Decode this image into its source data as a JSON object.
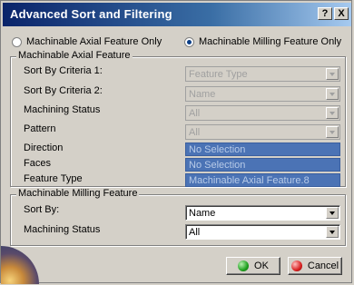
{
  "window": {
    "title": "Advanced Sort and Filtering"
  },
  "titlebar_buttons": {
    "help": "?",
    "close": "X"
  },
  "radios": [
    {
      "label": "Machinable Axial Feature Only",
      "selected": false
    },
    {
      "label": "Machinable Milling Feature Only",
      "selected": true
    }
  ],
  "axial": {
    "title": "Machinable Axial Feature",
    "rows": [
      {
        "label": "Sort By Criteria 1:",
        "value": "Feature Type"
      },
      {
        "label": "Sort By Criteria 2:",
        "value": "Name"
      },
      {
        "label": "Machining Status",
        "value": "All"
      },
      {
        "label": "Pattern",
        "value": "All"
      }
    ],
    "selections": [
      {
        "label": "Direction",
        "value": "No Selection"
      },
      {
        "label": "Faces",
        "value": "No Selection"
      },
      {
        "label": "Feature Type",
        "value": "Machinable Axial Feature.8"
      }
    ]
  },
  "milling": {
    "title": "Machinable Milling Feature",
    "rows": [
      {
        "label": "Sort By:",
        "value": "Name"
      },
      {
        "label": "Machining Status",
        "value": "All"
      }
    ]
  },
  "buttons": {
    "ok": "OK",
    "cancel": "Cancel"
  },
  "colors": {
    "ok_icon": "#1fa11f",
    "cancel_icon": "#d82020"
  }
}
